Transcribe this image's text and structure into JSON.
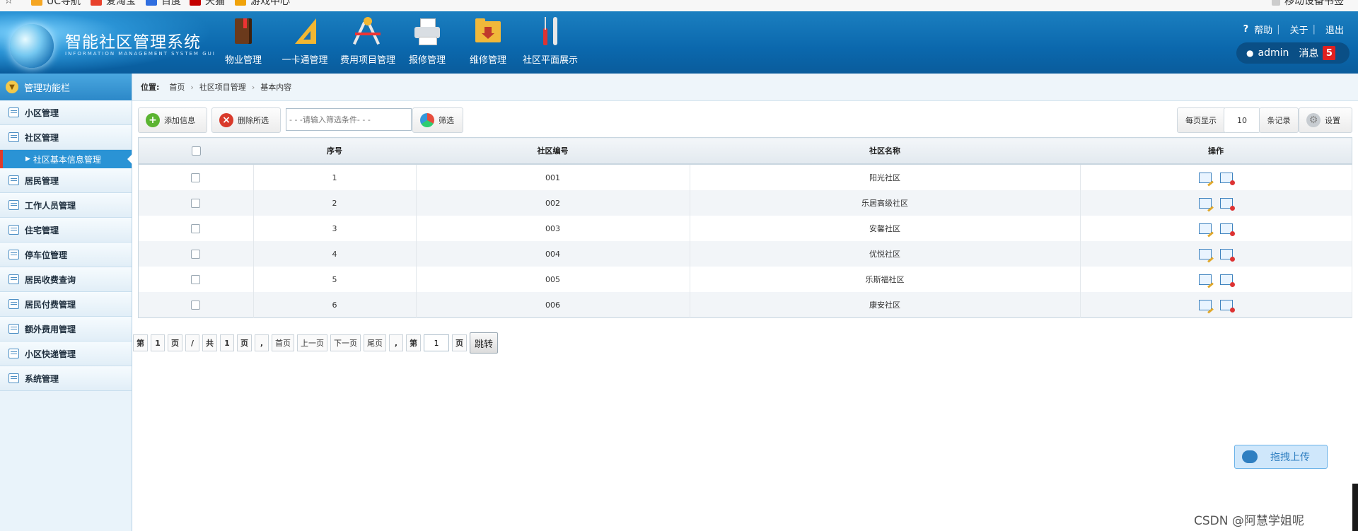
{
  "browser": {
    "bookmarks": [
      "UC导航",
      "爱淘宝",
      "百度",
      "天猫",
      "游戏中心"
    ],
    "right_link": "移动设备书签"
  },
  "header": {
    "title": "智能社区管理系统",
    "subtitle": "INFORMATION MANAGEMENT SYSTEM GUI",
    "nav": [
      {
        "label": "物业管理",
        "icon": "book-icon"
      },
      {
        "label": "一卡通管理",
        "icon": "ruler-icon"
      },
      {
        "label": "费用项目管理",
        "icon": "drafting-tools-icon"
      },
      {
        "label": "报修管理",
        "icon": "printer-icon"
      },
      {
        "label": "维修管理",
        "icon": "folder-download-icon"
      },
      {
        "label": "社区平面展示",
        "icon": "tools-icon"
      }
    ],
    "links": {
      "help": "帮助",
      "about": "关于",
      "logout": "退出"
    },
    "user": "admin",
    "messages_label": "消息",
    "message_count": "5"
  },
  "sidebar": {
    "title": "管理功能栏",
    "items": [
      {
        "label": "小区管理"
      },
      {
        "label": "社区管理"
      },
      {
        "label": "居民管理"
      },
      {
        "label": "工作人员管理"
      },
      {
        "label": "住宅管理"
      },
      {
        "label": "停车位管理"
      },
      {
        "label": "居民收费查询"
      },
      {
        "label": "居民付费管理"
      },
      {
        "label": "额外费用管理"
      },
      {
        "label": "小区快递管理"
      },
      {
        "label": "系统管理"
      }
    ],
    "active_sub": "社区基本信息管理"
  },
  "breadcrumb": {
    "label": "位置:",
    "items": [
      "首页",
      "社区项目管理",
      "基本内容"
    ]
  },
  "toolbar": {
    "add": "添加信息",
    "delete": "删除所选",
    "filter_placeholder": "- - -请输入筛选条件- - -",
    "filter_btn": "筛选",
    "per_page_label": "每页显示",
    "per_page_value": "10",
    "records_label": "条记录",
    "settings": "设置"
  },
  "table": {
    "headers": [
      "序号",
      "社区编号",
      "社区名称",
      "操作"
    ],
    "rows": [
      {
        "no": "1",
        "code": "001",
        "name": "阳光社区"
      },
      {
        "no": "2",
        "code": "002",
        "name": "乐居高级社区"
      },
      {
        "no": "3",
        "code": "003",
        "name": "安馨社区"
      },
      {
        "no": "4",
        "code": "004",
        "name": "优悦社区"
      },
      {
        "no": "5",
        "code": "005",
        "name": "乐斯福社区"
      },
      {
        "no": "6",
        "code": "006",
        "name": "康安社区"
      }
    ]
  },
  "pager": {
    "di": "第",
    "page": "1",
    "ye": "页",
    "slash": "/",
    "gong": "共",
    "total": "1",
    "ye2": "页",
    "comma": ",",
    "first": "首页",
    "prev": "上一页",
    "next": "下一页",
    "last": "尾页",
    "comma2": ",",
    "di2": "第",
    "goto_value": "1",
    "ye3": "页",
    "jump": "跳转"
  },
  "upload_widget": "拖拽上传",
  "watermark": "CSDN @阿慧学姐呢",
  "colors": {
    "header": "#0b68ad",
    "sidebar_active": "#2a93d5",
    "badge": "#e02020"
  }
}
